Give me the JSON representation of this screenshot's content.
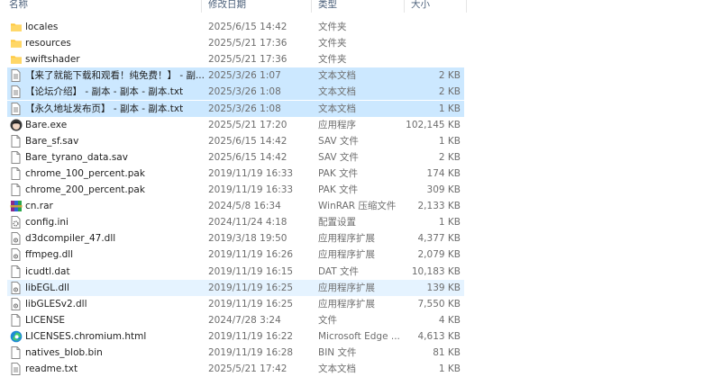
{
  "columns": {
    "name": "名称",
    "date": "修改日期",
    "type": "类型",
    "size": "大小"
  },
  "files": [
    {
      "name": "locales",
      "date": "2025/6/15 14:42",
      "type": "文件夹",
      "size": "",
      "icon": "folder-icon",
      "state": ""
    },
    {
      "name": "resources",
      "date": "2025/5/21 17:36",
      "type": "文件夹",
      "size": "",
      "icon": "folder-icon",
      "state": ""
    },
    {
      "name": "swiftshader",
      "date": "2025/5/21 17:36",
      "type": "文件夹",
      "size": "",
      "icon": "folder-icon",
      "state": ""
    },
    {
      "name": "【来了就能下载和观看！纯免费！】 - 副...",
      "date": "2025/3/26 1:07",
      "type": "文本文档",
      "size": "2 KB",
      "icon": "text-file-icon",
      "state": "selected"
    },
    {
      "name": "【论坛介绍】 - 副本 - 副本 - 副本.txt",
      "date": "2025/3/26 1:08",
      "type": "文本文档",
      "size": "2 KB",
      "icon": "text-file-icon",
      "state": "selected"
    },
    {
      "name": "【永久地址发布页】 - 副本 - 副本.txt",
      "date": "2025/3/26 1:08",
      "type": "文本文档",
      "size": "1 KB",
      "icon": "text-file-icon",
      "state": "selected"
    },
    {
      "name": "Bare.exe",
      "date": "2025/5/21 17:20",
      "type": "应用程序",
      "size": "102,145 KB",
      "icon": "app-avatar-icon",
      "state": ""
    },
    {
      "name": "Bare_sf.sav",
      "date": "2025/6/15 14:42",
      "type": "SAV 文件",
      "size": "1 KB",
      "icon": "file-icon",
      "state": ""
    },
    {
      "name": "Bare_tyrano_data.sav",
      "date": "2025/6/15 14:42",
      "type": "SAV 文件",
      "size": "2 KB",
      "icon": "file-icon",
      "state": ""
    },
    {
      "name": "chrome_100_percent.pak",
      "date": "2019/11/19 16:33",
      "type": "PAK 文件",
      "size": "174 KB",
      "icon": "file-icon",
      "state": ""
    },
    {
      "name": "chrome_200_percent.pak",
      "date": "2019/11/19 16:33",
      "type": "PAK 文件",
      "size": "309 KB",
      "icon": "file-icon",
      "state": ""
    },
    {
      "name": "cn.rar",
      "date": "2024/5/8 16:34",
      "type": "WinRAR 压缩文件",
      "size": "2,133 KB",
      "icon": "winrar-archive-icon",
      "state": ""
    },
    {
      "name": "config.ini",
      "date": "2024/11/24 4:18",
      "type": "配置设置",
      "size": "1 KB",
      "icon": "config-gear-icon",
      "state": ""
    },
    {
      "name": "d3dcompiler_47.dll",
      "date": "2019/3/18 19:50",
      "type": "应用程序扩展",
      "size": "4,377 KB",
      "icon": "dll-file-icon",
      "state": ""
    },
    {
      "name": "ffmpeg.dll",
      "date": "2019/11/19 16:26",
      "type": "应用程序扩展",
      "size": "2,079 KB",
      "icon": "dll-file-icon",
      "state": ""
    },
    {
      "name": "icudtl.dat",
      "date": "2019/11/19 16:15",
      "type": "DAT 文件",
      "size": "10,183 KB",
      "icon": "file-icon",
      "state": ""
    },
    {
      "name": "libEGL.dll",
      "date": "2019/11/19 16:25",
      "type": "应用程序扩展",
      "size": "139 KB",
      "icon": "dll-file-icon",
      "state": "hover"
    },
    {
      "name": "libGLESv2.dll",
      "date": "2019/11/19 16:25",
      "type": "应用程序扩展",
      "size": "7,550 KB",
      "icon": "dll-file-icon",
      "state": ""
    },
    {
      "name": "LICENSE",
      "date": "2024/7/28 3:24",
      "type": "文件",
      "size": "4 KB",
      "icon": "file-icon",
      "state": ""
    },
    {
      "name": "LICENSES.chromium.html",
      "date": "2019/11/19 16:22",
      "type": "Microsoft Edge ...",
      "size": "4,613 KB",
      "icon": "edge-browser-icon",
      "state": ""
    },
    {
      "name": "natives_blob.bin",
      "date": "2019/11/19 16:28",
      "type": "BIN 文件",
      "size": "81 KB",
      "icon": "file-icon",
      "state": ""
    },
    {
      "name": "readme.txt",
      "date": "2025/5/21 17:42",
      "type": "文本文档",
      "size": "1 KB",
      "icon": "text-file-icon",
      "state": ""
    }
  ],
  "colors": {
    "selected": "#cce8ff",
    "hover": "#e5f3ff",
    "folder": "#ffc83d",
    "header_text": "#4c607a"
  }
}
